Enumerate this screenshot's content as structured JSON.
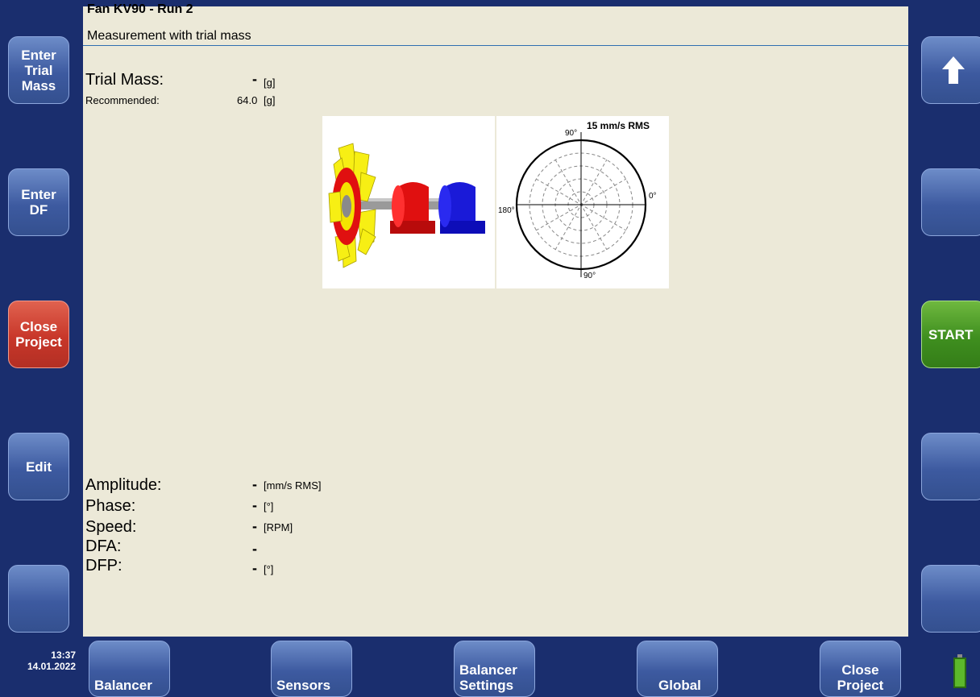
{
  "header": {
    "title": "Fan KV90 - Run 2",
    "subtitle": "Measurement with trial mass"
  },
  "trial_mass": {
    "label": "Trial Mass:",
    "value": "-",
    "unit": "[g]",
    "recommended_label": "Recommended:",
    "recommended_value": "64.0",
    "recommended_unit": "[g]"
  },
  "polar": {
    "scale_label": "15 mm/s RMS",
    "angle_top": "90°",
    "angle_right": "0°",
    "angle_left": "180°",
    "angle_bottom": "90°"
  },
  "results": [
    {
      "label": "Amplitude:",
      "value": "-",
      "unit": "[mm/s RMS]"
    },
    {
      "label": "Phase:",
      "value": "-",
      "unit": "[°]"
    },
    {
      "label": "Speed:",
      "value": "-",
      "unit": "[RPM]"
    },
    {
      "label": "DFA:",
      "value": "-",
      "unit": ""
    },
    {
      "label": "DFP:",
      "value": "-",
      "unit": "[°]"
    }
  ],
  "left_buttons": {
    "enter_trial_mass": "Enter\nTrial\nMass",
    "enter_df": "Enter\nDF",
    "close_project": "Close\nProject",
    "edit": "Edit"
  },
  "right_buttons": {
    "start": "START"
  },
  "bottom_buttons": {
    "balancer": "Balancer",
    "sensors": "Sensors",
    "balancer_settings": "Balancer\nSettings",
    "global": "Global",
    "close_project": "Close\nProject"
  },
  "status": {
    "time": "13:37",
    "date": "14.01.2022"
  },
  "colors": {
    "frame": "#1a2e6e",
    "panel": "#ece9d8",
    "button_blue": "#3d5aa0",
    "button_red": "#c8372a",
    "button_green": "#3f8f1f",
    "battery": "#5cb82c"
  }
}
